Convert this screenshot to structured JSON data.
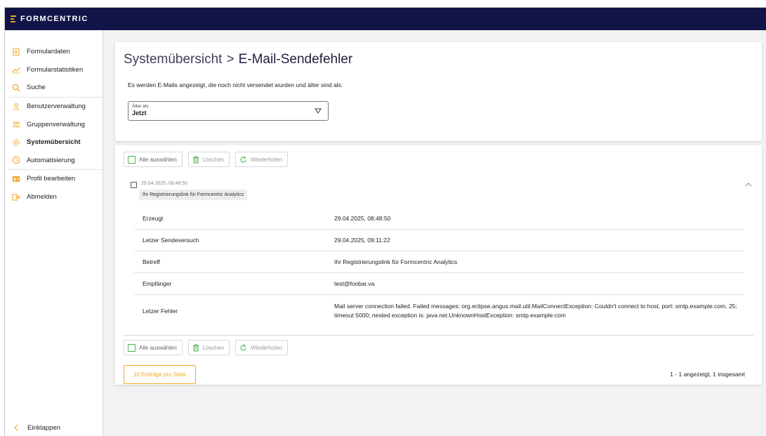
{
  "app": {
    "logo_text": "FORMCENTRIC",
    "brand_color": "#121347",
    "accent_color": "#f5a623"
  },
  "sidebar": {
    "items": [
      {
        "label": "Formulardaten",
        "icon": "form-icon"
      },
      {
        "label": "Formularstatistiken",
        "icon": "chart-icon"
      },
      {
        "label": "Suche",
        "icon": "search-icon"
      },
      {
        "label": "Benutzerverwaltung",
        "icon": "user-icon"
      },
      {
        "label": "Gruppenverwaltung",
        "icon": "group-icon"
      },
      {
        "label": "Systemübersicht",
        "icon": "gear-icon",
        "active": true
      },
      {
        "label": "Automatisierung",
        "icon": "clock-icon"
      },
      {
        "label": "Profil bearbeiten",
        "icon": "id-card-icon"
      },
      {
        "label": "Abmelden",
        "icon": "logout-icon"
      }
    ],
    "collapse_label": "Einklappen"
  },
  "header": {
    "breadcrumb_parent": "Systemübersicht",
    "separator": ">",
    "title": "E-Mail-Sendefehler",
    "info_text": "Es werden E-Mails angezeigt, die noch nicht versendet wurden und älter sind als:",
    "filter": {
      "label": "Älter als",
      "value": "Jetzt"
    }
  },
  "toolbar": {
    "select_all_label": "Alle auswählen",
    "delete_label": "Löschen",
    "retry_label": "Wiederholen"
  },
  "mail": {
    "date": "29.04.2025, 08:48:50",
    "subject": "Ihr Registrierungslink für Formcentric Analytics",
    "details": [
      {
        "key": "Erzeugt",
        "value": "29.04.2025, 08:48:50"
      },
      {
        "key": "Letzer Sendeversuch",
        "value": "29.04.2025, 09:11:22"
      },
      {
        "key": "Betreff",
        "value": "Ihr Registrierungslink für Formcentric Analytics"
      },
      {
        "key": "Empfänger",
        "value": "test@foobar.va"
      },
      {
        "key": "Letzer Fehler",
        "value": "Mail server connection failed. Failed messages: org.eclipse.angus.mail.util.MailConnectException: Couldn't connect to host, port: smtp.example.com, 25; timeout 5000; nested exception is: java.net.UnknownHostException: smtp.example.com"
      }
    ]
  },
  "pagination": {
    "per_page_label": "10 Einträge pro Seite",
    "summary": "1 - 1 angezeigt, 1 insgesamt"
  }
}
